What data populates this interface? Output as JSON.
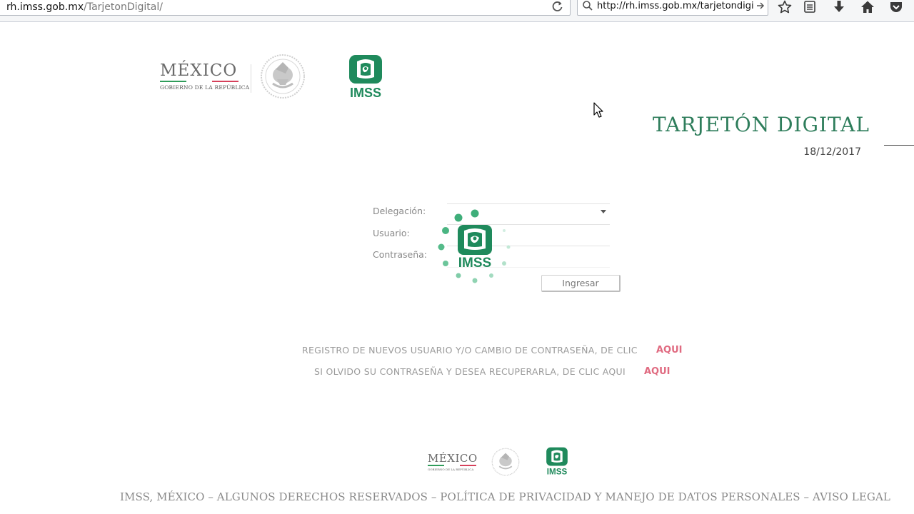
{
  "browser": {
    "url_host": "rh.imss.gob.mx",
    "url_path": "/TarjetonDigital/",
    "search_value": "http://rh.imss.gob.mx/tarjetondigital"
  },
  "header": {
    "mexico_title": "MÉXICO",
    "mexico_subtitle": "GOBIERNO DE LA REPÚBLICA",
    "imss_logo_text": "IMSS",
    "page_title": "TARJETÓN DIGITAL",
    "date": "18/12/2017"
  },
  "form": {
    "delegacion_label": "Delegación:",
    "usuario_label": "Usuario:",
    "contrasena_label": "Contraseña:",
    "submit_label": "Ingresar"
  },
  "loader": {
    "logo_text": "IMSS"
  },
  "links": {
    "register_text": "REGISTRO DE NUEVOS USUARIO Y/O CAMBIO DE CONTRASEÑA, DE CLIC",
    "register_link": "AQUI",
    "recover_text": "SI OLVIDO SU CONTRASEÑA Y DESEA RECUPERARLA, DE CLIC AQUI",
    "recover_link": "AQUI"
  },
  "footer": {
    "mexico_title": "MÉXICO",
    "mexico_subtitle": "GOBIERNO DE LA REPÚBLICA",
    "imss_logo_text": "IMSS",
    "text": "IMSS, MÉXICO – ALGUNOS DERECHOS RESERVADOS – POLÍTICA DE PRIVACIDAD Y MANEJO DE DATOS PERSONALES – AVISO LEGAL"
  },
  "colors": {
    "imss_green": "#1f8a5c",
    "title_green": "#2e7d5b",
    "link_pink": "#e06a80",
    "flag_green": "#2f9c5a",
    "flag_red": "#d6415b"
  }
}
